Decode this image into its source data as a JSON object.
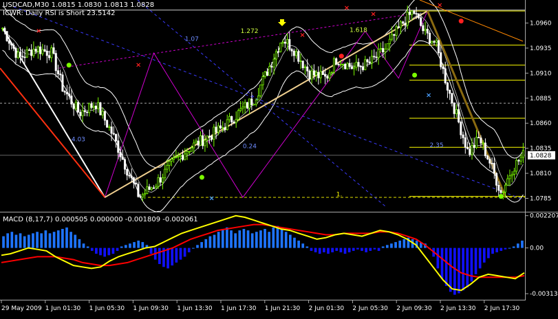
{
  "header": {
    "symbol_line": "USDCAD,M30  1.0815 1.0830 1.0813 1.0828",
    "indicator_line": "ICWR: Daily RSI is Short 23.5142"
  },
  "colors": {
    "background": "#000000",
    "bull": "#7cfc00",
    "bear": "#ffffff",
    "bollinger": "#ffffff",
    "fib": "#ffff00",
    "zigzag": "#d000d0",
    "macd_hist": "#1e74ff",
    "macd_hist_neg": "#1010ff",
    "macd_line": "#ffff00",
    "signal_line": "#ff0000",
    "price_label_bg": "#ffffff"
  },
  "chart_data": [
    {
      "type": "candlestick",
      "title": "USDCAD,M30",
      "ylim": [
        1.0773,
        1.0983
      ],
      "y_ticks": [
        "1.0960",
        "1.0935",
        "1.0910",
        "1.0885",
        "1.0860",
        "1.0835",
        "1.0810",
        "1.0785"
      ],
      "current_price": "1.0828",
      "x_tick_labels": [
        "29 May 2009",
        "1 Jun 01:30",
        "1 Jun 05:30",
        "1 Jun 09:30",
        "1 Jun 13:30",
        "1 Jun 17:30",
        "1 Jun 21:30",
        "2 Jun 01:30",
        "2 Jun 05:30",
        "2 Jun 09:30",
        "2 Jun 13:30",
        "2 Jun 17:30"
      ],
      "anchor_closes": [
        [
          0,
          1.0955
        ],
        [
          6,
          1.0925
        ],
        [
          12,
          1.0935
        ],
        [
          18,
          1.093
        ],
        [
          22,
          1.0895
        ],
        [
          28,
          1.087
        ],
        [
          34,
          1.088
        ],
        [
          40,
          1.085
        ],
        [
          46,
          1.081
        ],
        [
          50,
          1.0786
        ],
        [
          56,
          1.08
        ],
        [
          62,
          1.082
        ],
        [
          68,
          1.0835
        ],
        [
          74,
          1.0845
        ],
        [
          80,
          1.0855
        ],
        [
          86,
          1.087
        ],
        [
          92,
          1.0885
        ],
        [
          98,
          1.092
        ],
        [
          102,
          1.0945
        ],
        [
          106,
          1.0935
        ],
        [
          112,
          1.091
        ],
        [
          118,
          1.0905
        ],
        [
          122,
          1.0925
        ],
        [
          128,
          1.0915
        ],
        [
          134,
          1.092
        ],
        [
          140,
          1.0935
        ],
        [
          146,
          1.096
        ],
        [
          150,
          1.0972
        ],
        [
          154,
          1.095
        ],
        [
          158,
          1.094
        ],
        [
          162,
          1.09
        ],
        [
          166,
          1.0865
        ],
        [
          170,
          1.083
        ],
        [
          174,
          1.0845
        ],
        [
          178,
          1.082
        ],
        [
          182,
          1.079
        ],
        [
          186,
          1.0815
        ],
        [
          190,
          1.0828
        ]
      ],
      "fib_levels": [
        {
          "value": 1.0972,
          "label": "1."
        },
        {
          "value": 1.0938,
          "label": ""
        },
        {
          "value": 1.0918,
          "label": ""
        },
        {
          "value": 1.0903,
          "label": ""
        },
        {
          "value": 1.0865,
          "label": ""
        },
        {
          "value": 1.0836,
          "label": "2.35"
        },
        {
          "value": 1.0787,
          "label": "1."
        }
      ],
      "annotations": [
        "1.07",
        "1.272",
        "1.618",
        "4.03",
        "0.24",
        "2.35",
        "1."
      ],
      "signals_sell": [
        [
          16,
          1.0952
        ],
        [
          61,
          1.0918
        ],
        [
          135,
          1.0948
        ],
        [
          167,
          1.0969
        ],
        [
          197,
          1.0978
        ],
        [
          155,
          1.0975
        ]
      ],
      "signals_buy": [
        [
          94,
          1.0785
        ],
        [
          192,
          1.0888
        ]
      ],
      "markers_green": [
        [
          30,
          1.0918
        ],
        [
          90,
          1.0806
        ],
        [
          186,
          1.0908
        ],
        [
          225,
          1.0787
        ]
      ],
      "markers_red": [
        [
          153,
          1.0927
        ],
        [
          207,
          1.0962
        ]
      ]
    },
    {
      "type": "bar",
      "title": "MACD (8,17,7) 0.000505 0.000000 -0.001809 -0.002061",
      "parameters": "8,17,7",
      "values_label": [
        "0.000505",
        "0.000000",
        "-0.001809",
        "-0.002061"
      ],
      "ylim": [
        -0.00345,
        0.00238
      ],
      "y_ticks": [
        "0.002207",
        "0.00",
        "-0.00313"
      ],
      "histogram": [
        0.0008,
        0.001,
        0.0011,
        0.0009,
        0.001,
        0.0008,
        0.0009,
        0.001,
        0.0011,
        0.001,
        0.0012,
        0.001,
        0.0011,
        0.0012,
        0.0013,
        0.0014,
        0.0011,
        0.0009,
        0.0006,
        0.0003,
        0.0001,
        -0.0002,
        -0.0004,
        -0.0005,
        -0.0006,
        -0.0005,
        -0.0004,
        -0.0002,
        0.0001,
        0.0002,
        0.0003,
        0.0004,
        0.0005,
        0.0004,
        0.0002,
        -0.0004,
        -0.0008,
        -0.0011,
        -0.0013,
        -0.0014,
        -0.0012,
        -0.001,
        -0.0008,
        -0.0006,
        -0.0003,
        0.0,
        0.0002,
        0.0004,
        0.0006,
        0.0008,
        0.0009,
        0.0011,
        0.0013,
        0.0014,
        0.0012,
        0.001,
        0.0012,
        0.0013,
        0.0012,
        0.001,
        0.0011,
        0.0012,
        0.0013,
        0.0011,
        0.0014,
        0.0015,
        0.0013,
        0.0011,
        0.0009,
        0.0007,
        0.0005,
        0.0003,
        0.0001,
        -0.0002,
        -0.0003,
        -0.0004,
        -0.0003,
        -0.0004,
        -0.0003,
        -0.0002,
        -0.0003,
        -0.0004,
        -0.0003,
        -0.0002,
        -0.0001,
        -0.0002,
        -0.0003,
        -0.0002,
        -0.0001,
        -0.0002,
        0.0001,
        0.0002,
        0.0003,
        0.0004,
        0.0005,
        0.0006,
        0.0007,
        0.0006,
        0.0005,
        0.0004,
        0.0003,
        0.0,
        -0.0006,
        -0.0014,
        -0.0021,
        -0.0026,
        -0.003,
        -0.0032,
        -0.0031,
        -0.0029,
        -0.0027,
        -0.0023,
        -0.0018,
        -0.0014,
        -0.001,
        -0.0007,
        -0.0004,
        -0.0003,
        -0.0002,
        -0.0001,
        0.0,
        0.0001,
        0.0003,
        0.0005
      ],
      "macd_line": [
        -0.0005,
        -0.0004,
        -0.0002,
        0.0,
        -0.0001,
        -0.0002,
        -0.0006,
        -0.0009,
        -0.0012,
        -0.0013,
        -0.0014,
        -0.0013,
        -0.0009,
        -0.0006,
        -0.0004,
        -0.0002,
        0.0,
        0.0001,
        0.0004,
        0.0007,
        0.001,
        0.0012,
        0.0014,
        0.0016,
        0.0018,
        0.002,
        0.0022,
        0.0021,
        0.0019,
        0.0017,
        0.0015,
        0.0013,
        0.0012,
        0.001,
        0.0008,
        0.0006,
        0.0007,
        0.0009,
        0.001,
        0.0009,
        0.0008,
        0.001,
        0.0012,
        0.0011,
        0.0009,
        0.0006,
        0.0002,
        -0.0006,
        -0.0014,
        -0.0022,
        -0.0028,
        -0.0029,
        -0.0025,
        -0.002,
        -0.0018,
        -0.0019,
        -0.002,
        -0.0021,
        -0.0017
      ],
      "signal_line": [
        -0.001,
        -0.0009,
        -0.0008,
        -0.0007,
        -0.0006,
        -0.0006,
        -0.0006,
        -0.0007,
        -0.0008,
        -0.001,
        -0.0011,
        -0.0012,
        -0.0012,
        -0.0011,
        -0.001,
        -0.0008,
        -0.0006,
        -0.0004,
        -0.0002,
        0.0,
        0.0003,
        0.0006,
        0.0008,
        0.001,
        0.0012,
        0.0013,
        0.0014,
        0.0015,
        0.0016,
        0.0016,
        0.0015,
        0.0014,
        0.0013,
        0.0012,
        0.0011,
        0.001,
        0.0009,
        0.0009,
        0.001,
        0.001,
        0.001,
        0.001,
        0.0011,
        0.0011,
        0.001,
        0.0008,
        0.0006,
        0.0002,
        -0.0003,
        -0.0008,
        -0.0013,
        -0.0017,
        -0.0019,
        -0.002,
        -0.002,
        -0.002,
        -0.002,
        -0.002,
        -0.0019
      ]
    }
  ]
}
